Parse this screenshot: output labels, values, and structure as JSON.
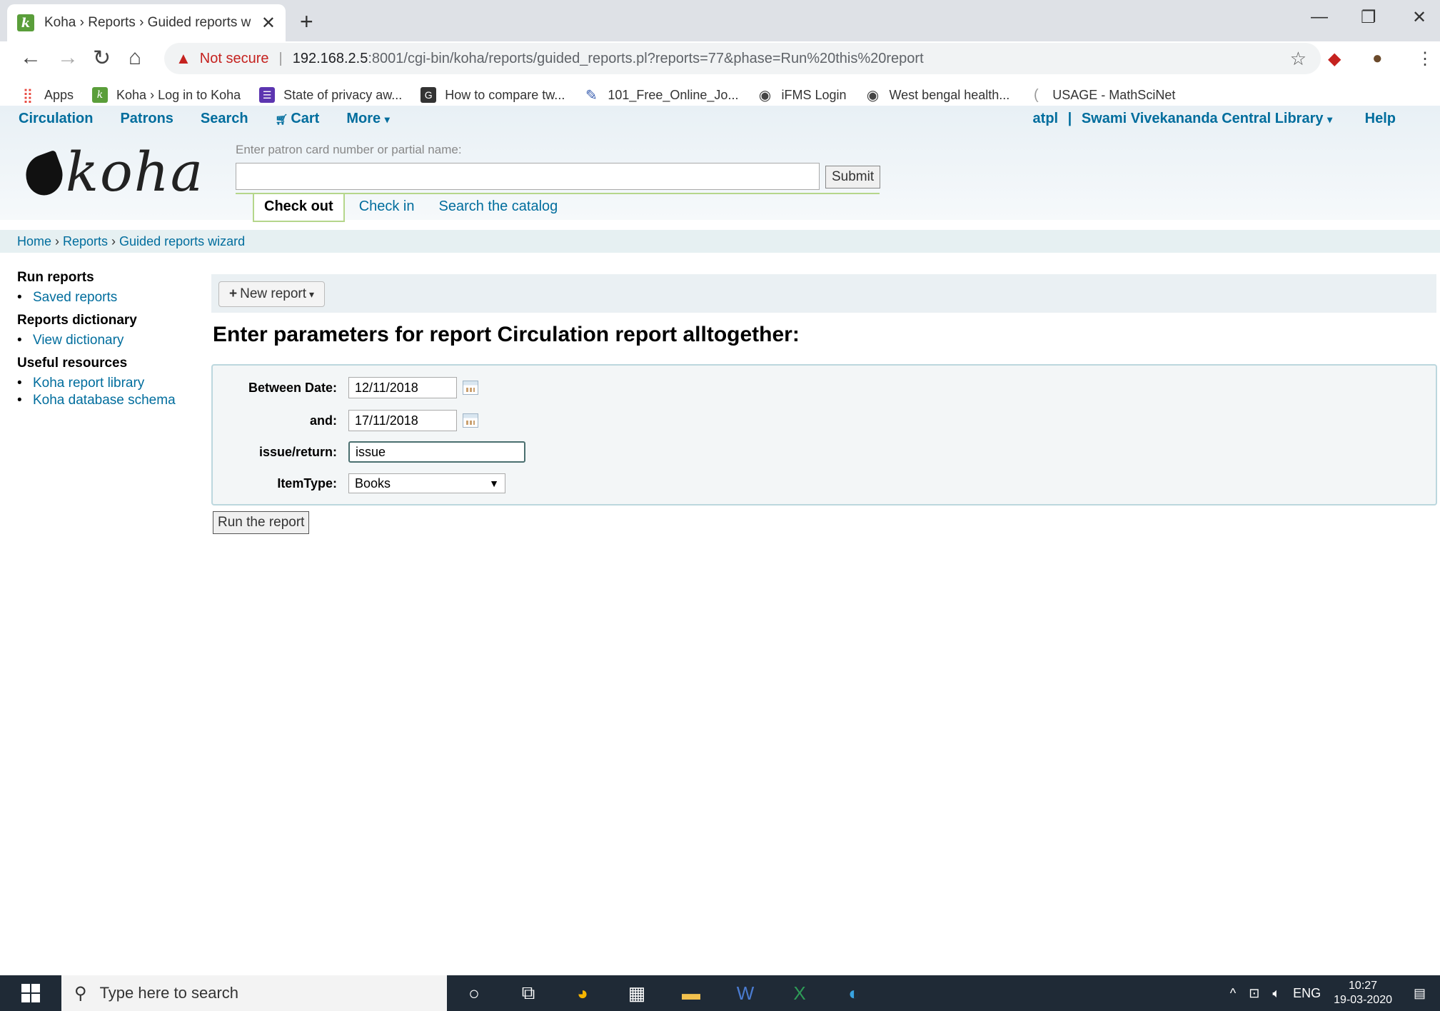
{
  "browser": {
    "tab_title": "Koha › Reports › Guided reports w",
    "new_tab": "+",
    "security_label": "Not secure",
    "url_host": "192.168.2.5",
    "url_rest": ":8001/cgi-bin/koha/reports/guided_reports.pl?reports=77&phase=Run%20this%20report",
    "bookmarks": [
      {
        "label": "Apps",
        "icon": "apps-grid-icon",
        "color": "#e8453c"
      },
      {
        "label": "Koha › Log in to Koha",
        "icon": "koha-favicon",
        "color": "#5a9e3a"
      },
      {
        "label": "State of privacy aw...",
        "icon": "list-favicon",
        "color": "#5c35b0"
      },
      {
        "label": "How to compare tw...",
        "icon": "g-favicon",
        "color": "#333333"
      },
      {
        "label": "101_Free_Online_Jo...",
        "icon": "feather-favicon",
        "color": "#3a5fb0"
      },
      {
        "label": "iFMS Login",
        "icon": "globe-icon",
        "color": "#555555"
      },
      {
        "label": "West bengal health...",
        "icon": "globe-icon",
        "color": "#555555"
      },
      {
        "label": "USAGE - MathSciNet",
        "icon": "mathscinet-favicon",
        "color": "#999999"
      }
    ]
  },
  "koha": {
    "topnav": [
      "Circulation",
      "Patrons",
      "Search",
      "Cart",
      "More"
    ],
    "user": "atpl",
    "library": "Swami Vivekananda Central Library",
    "help": "Help",
    "logo_text": "koha",
    "patron_label": "Enter patron card number or partial name:",
    "submit": "Submit",
    "tabs": [
      "Check out",
      "Check in",
      "Search the catalog"
    ],
    "breadcrumbs": [
      "Home",
      "Reports",
      "Guided reports wizard"
    ]
  },
  "sidebar": {
    "sections": [
      {
        "heading": "Run reports",
        "items": [
          "Saved reports"
        ]
      },
      {
        "heading": "Reports dictionary",
        "items": [
          "View dictionary"
        ]
      },
      {
        "heading": "Useful resources",
        "items": [
          "Koha report library",
          "Koha database schema"
        ]
      }
    ]
  },
  "main": {
    "new_report": "New report",
    "title": "Enter parameters for report Circulation report alltogether:",
    "params": [
      {
        "label": "Between Date:",
        "value": "12/11/2018"
      },
      {
        "label": "and:",
        "value": "17/11/2018"
      },
      {
        "label": "issue/return:",
        "value": "issue"
      },
      {
        "label": "ItemType:",
        "value": "Books"
      }
    ],
    "run": "Run the report"
  },
  "taskbar": {
    "search_placeholder": "Type here to search",
    "lang": "ENG",
    "time": "10:27",
    "date": "19-03-2020"
  }
}
